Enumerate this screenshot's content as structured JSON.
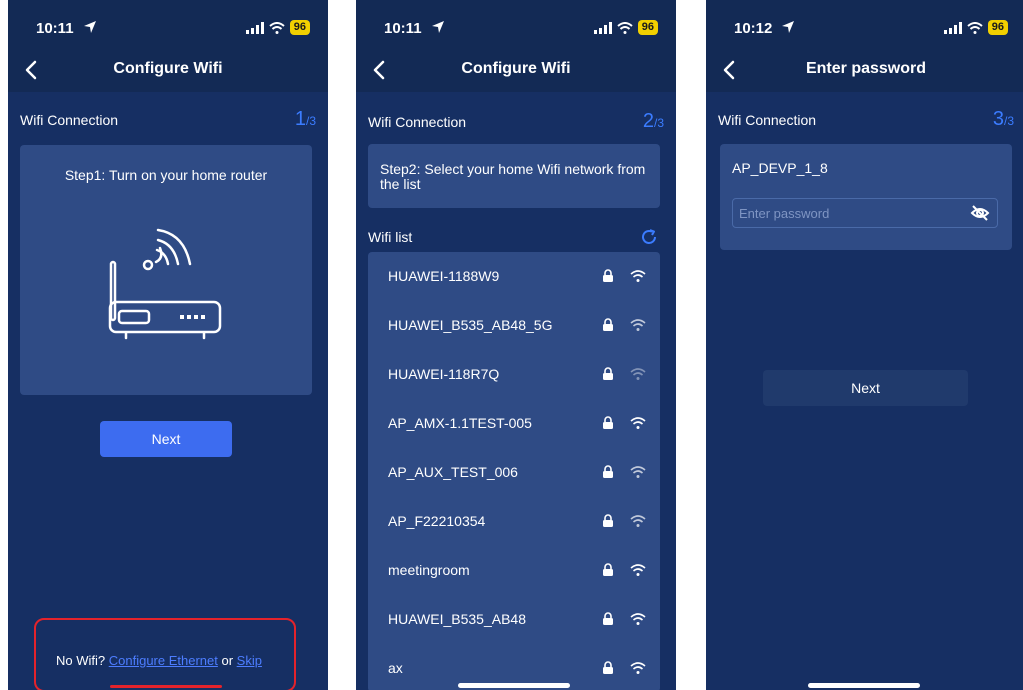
{
  "status": {
    "time1": "10:11",
    "time2": "10:11",
    "time3": "10:12",
    "battery": "96"
  },
  "screen1": {
    "title": "Configure Wifi",
    "section": "Wifi Connection",
    "step_current": "1",
    "step_total": "/3",
    "instruction": "Step1: Turn on your home router",
    "next_label": "Next",
    "footer_prefix": "No Wifi? ",
    "footer_link1": "Configure Ethernet",
    "footer_mid": " or ",
    "footer_link2": "Skip"
  },
  "screen2": {
    "title": "Configure Wifi",
    "section": "Wifi Connection",
    "step_current": "2",
    "step_total": "/3",
    "instruction": "Step2: Select your home Wifi network from the list",
    "list_label": "Wifi list",
    "networks": [
      {
        "name": "HUAWEI-1188W9",
        "signal": "strong"
      },
      {
        "name": "HUAWEI_B535_AB48_5G",
        "signal": "medium"
      },
      {
        "name": "HUAWEI-118R7Q",
        "signal": "weak"
      },
      {
        "name": "AP_AMX-1.1TEST-005",
        "signal": "strong"
      },
      {
        "name": "AP_AUX_TEST_006",
        "signal": "medium"
      },
      {
        "name": "AP_F22210354",
        "signal": "medium"
      },
      {
        "name": "meetingroom",
        "signal": "strong"
      },
      {
        "name": "HUAWEI_B535_AB48",
        "signal": "strong"
      },
      {
        "name": "ax",
        "signal": "strong"
      }
    ]
  },
  "screen3": {
    "title": "Enter password",
    "section": "Wifi Connection",
    "step_current": "3",
    "step_total": "/3",
    "ssid": "AP_DEVP_1_8",
    "password_placeholder": "Enter password",
    "next_label": "Next"
  },
  "colors": {
    "background": "#132a55",
    "card": "#2f4b85",
    "accent": "#3b7cff",
    "highlight": "#e4232b",
    "battery": "#f1d000"
  }
}
